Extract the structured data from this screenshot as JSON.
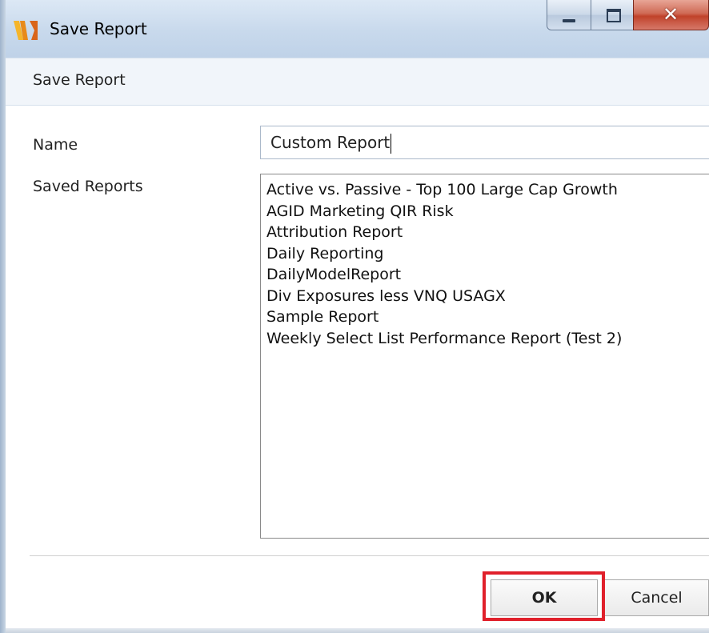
{
  "window": {
    "title": "Save Report",
    "controls": {
      "minimize": "minimize",
      "maximize": "maximize",
      "close": "close"
    }
  },
  "header": {
    "title": "Save Report"
  },
  "form": {
    "name_label": "Name",
    "name_value": "Custom Report",
    "saved_reports_label": "Saved Reports",
    "saved_reports": [
      "Active vs. Passive - Top 100 Large Cap Growth",
      "AGID Marketing QIR Risk",
      "Attribution Report",
      "Daily Reporting",
      "DailyModelReport",
      "Div Exposures less VNQ USAGX",
      "Sample Report",
      "Weekly Select List Performance Report (Test 2)"
    ]
  },
  "buttons": {
    "ok": "OK",
    "cancel": "Cancel"
  },
  "colors": {
    "highlight": "#e0202b",
    "close_button": "#c0422a",
    "icon_primary": "#f0a020"
  },
  "icons": {
    "app": "app-logo-icon",
    "minimize": "minimize-icon",
    "maximize": "maximize-icon",
    "close": "close-icon"
  }
}
